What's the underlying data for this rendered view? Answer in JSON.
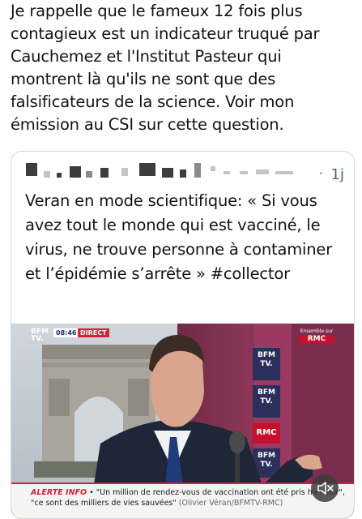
{
  "tweet": {
    "text": "Je rappelle que le fameux 12 fois plus contagieux est un indicateur truqué par Cauchemez et l'Institut Pasteur qui montrent là qu'ils ne sont que des falsificateurs de la science. Voir mon émission au CSI sur cette question."
  },
  "quote": {
    "time": "1j",
    "separator": "·",
    "text": "Veran en mode scientifique: « Si vous avez tout le monde qui est vacciné, le virus, ne trouve personne à contaminer et l’épidémie s’arrête » #collector",
    "video": {
      "channel_logo": "BFM TV.",
      "time_badge": "08:46",
      "direct_badge": "DIRECT",
      "rmc_corner_top": "Ensemble sur",
      "rmc_corner_logo": "RMC",
      "bfm_tile": "BFM TV.",
      "rmc_tile": "RMC",
      "ticker_alert": "ALERTE INFO",
      "ticker_bullet": " •",
      "ticker_quote": " \"Un million de rendez-vous de vaccination ont été pris hier soir\", \"ce sont des milliers de vies sauvées\"",
      "ticker_source": "(Olivier Véran/BFMTV-RMC)",
      "mute_icon": "volume-muted-icon"
    }
  },
  "colors": {
    "text": "#0f1419",
    "secondary_text": "#536471",
    "border": "#cfd9de",
    "alert_red": "#d4213c",
    "bfm_blue": "#2b2f5a",
    "rmc_red": "#c8102e"
  }
}
